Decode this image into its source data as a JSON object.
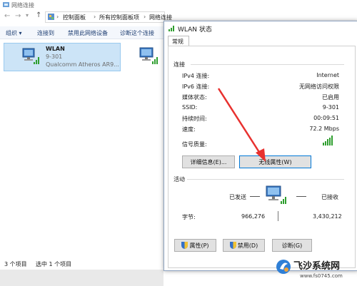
{
  "explorer": {
    "window_title": "网络连接",
    "breadcrumb": [
      "控制面板",
      "所有控制面板项",
      "网络连接"
    ],
    "toolbar": [
      "组织 ▾",
      "连接到",
      "禁用此网络设备",
      "诊断这个连接"
    ],
    "adapter": {
      "name": "WLAN",
      "network": "9-301",
      "device": "Qualcomm Atheros AR9..."
    },
    "status_bar": {
      "count": "3 个项目",
      "selected": "选中 1 个项目"
    }
  },
  "dialog": {
    "title": "WLAN 状态",
    "tab": "常规",
    "connection_group": "连接",
    "rows": [
      {
        "label": "IPv4 连接:",
        "value": "Internet"
      },
      {
        "label": "IPv6 连接:",
        "value": "无网络访问权限"
      },
      {
        "label": "媒体状态:",
        "value": "已启用"
      },
      {
        "label": "SSID:",
        "value": "9-301"
      },
      {
        "label": "持续时间:",
        "value": "00:09:51"
      },
      {
        "label": "速度:",
        "value": "72.2 Mbps"
      }
    ],
    "signal_label": "信号质量:",
    "details_button": "详细信息(E)...",
    "wireless_button": "无线属性(W)",
    "activity_group": "活动",
    "sent_label": "已发送",
    "received_label": "已接收",
    "bytes_label": "字节:",
    "bytes_sent": "966,276",
    "bytes_received": "3,430,212",
    "properties_button": "属性(P)",
    "disable_button": "禁用(D)",
    "diagnose_button": "诊断(G)",
    "signal_bars": 5
  },
  "watermark": {
    "brand": "飞沙系统网",
    "url": "www.fs0745.com"
  },
  "colors": {
    "accent_red": "#e8312f",
    "signal_green": "#2e9e2e",
    "selection": "#cce4f7"
  }
}
